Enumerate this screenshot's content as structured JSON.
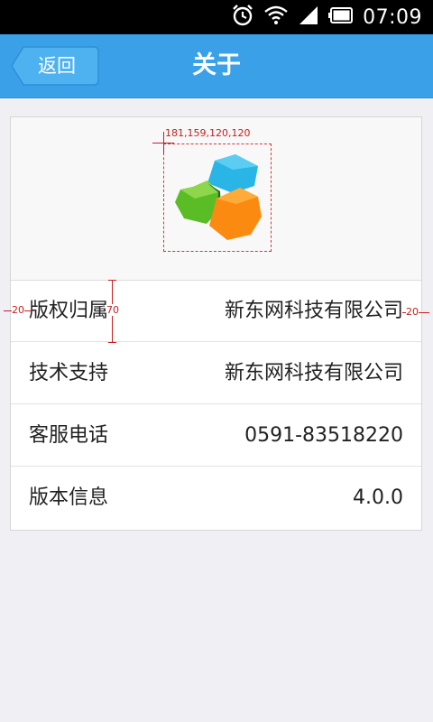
{
  "status_bar": {
    "time": "07:09",
    "icons": [
      "alarm-icon",
      "wifi-icon",
      "signal-icon",
      "battery-icon"
    ]
  },
  "header": {
    "back_label": "返回",
    "title": "关于",
    "color": "#3aa0e8"
  },
  "logo": {
    "annotation": "181,159,120,120"
  },
  "info_rows": [
    {
      "label": "版权归属",
      "value": "新东网科技有限公司"
    },
    {
      "label": "技术支持",
      "value": "新东网科技有限公司"
    },
    {
      "label": "客服电话",
      "value": "0591-83518220"
    },
    {
      "label": "版本信息",
      "value": "4.0.0"
    }
  ],
  "measurements": {
    "left_padding": "20",
    "right_padding": "20",
    "row_height": "70"
  }
}
